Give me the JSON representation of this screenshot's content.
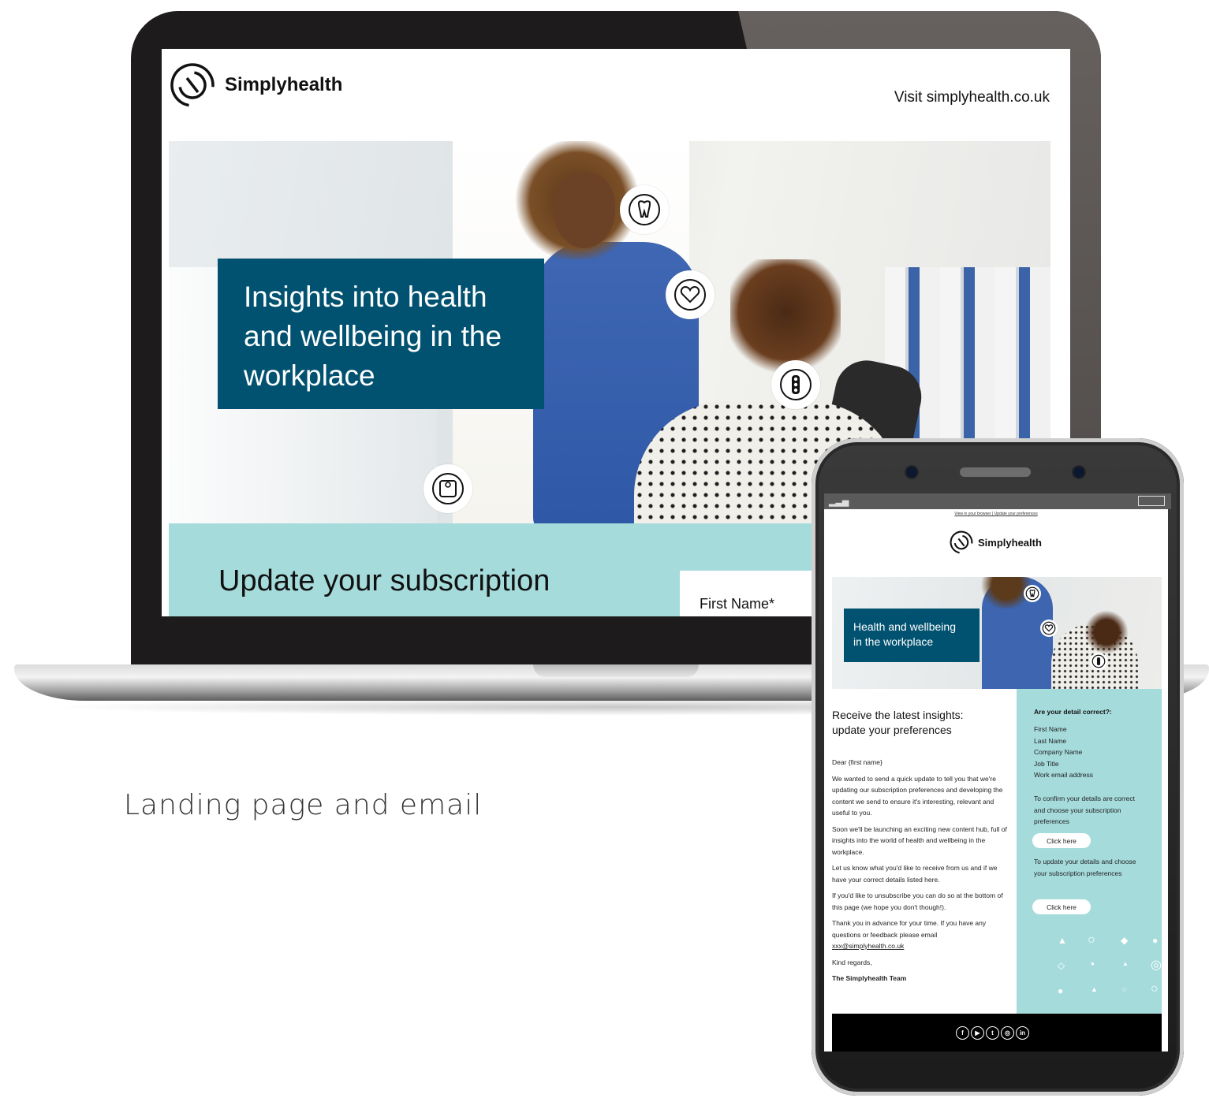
{
  "landing_page": {
    "brand": "Simplyhealth",
    "visit_link": "Visit simplyhealth.co.uk",
    "hero_title_lines": [
      "Insights into health",
      "and wellbeing in the",
      "workplace"
    ],
    "icons": [
      "tooth-icon",
      "heart-icon",
      "traffic-light-icon",
      "scales-icon"
    ],
    "update_title": "Update your subscription",
    "form_first_field": "First Name*"
  },
  "caption": "Landing page and email",
  "email": {
    "top_links": "View in your browser | Update your preferences",
    "brand": "Simplyhealth",
    "hero_title_lines": [
      "Health and wellbeing",
      "in the workplace"
    ],
    "heading_lines": [
      "Receive the latest insights:",
      "update your preferences"
    ],
    "greeting": "Dear {first name}",
    "paragraphs": [
      "We wanted to send a quick update to tell you that we're updating our subscription preferences and developing the content we send to ensure it's interesting, relevant and useful to you.",
      "Soon we'll be launching an exciting new content hub, full of insights into the world of health and wellbeing in the workplace.",
      "Let us know what you'd like to receive from us and if we have your correct details listed here.",
      "If you'd like to unsubscribe you can do so at the bottom of this page (we hope you don't though!).",
      "Thank you in advance for your time. If you have any questions or feedback please email"
    ],
    "email_address": "xxx@simplyhealth.co.uk",
    "sign_off": "Kind regards,",
    "signature": "The Simplyhealth Team",
    "sidebar": {
      "title": "Are your detail correct?:",
      "fields": [
        "First Name",
        "Last Name",
        "Company Name",
        "Job Title",
        "Work email address"
      ],
      "confirm_text": "To confirm your details are correct and choose your subscription preferences",
      "confirm_button": "Click here",
      "update_text": "To update your details and choose your subscription preferences",
      "update_button": "Click here"
    },
    "social": [
      "f",
      "▶",
      "t",
      "◎",
      "in"
    ]
  },
  "colors": {
    "brand_teal": "#015270",
    "light_teal": "#a6dbdc"
  }
}
